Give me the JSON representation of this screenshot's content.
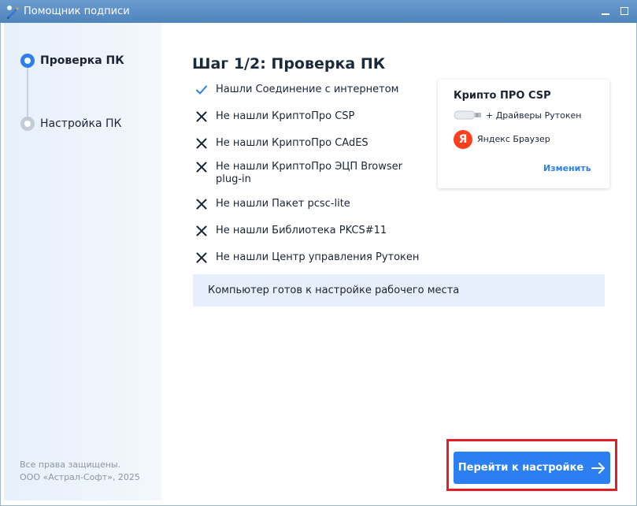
{
  "window": {
    "title": "Помощник подписи",
    "icon": "pen-signature-icon"
  },
  "sidebar": {
    "steps": [
      {
        "label": "Проверка ПК",
        "state": "active"
      },
      {
        "label": "Настройка ПК",
        "state": "inactive"
      }
    ],
    "footer": {
      "line1": "Все права защищены.",
      "line2": "ООО «Астрал-Софт», 2025"
    }
  },
  "main": {
    "title": "Шаг 1/2: Проверка ПК",
    "checks": [
      {
        "label": "Нашли Соединение с интернетом",
        "status": "ok"
      },
      {
        "label": "Не нашли КриптоПро CSP",
        "status": "missing"
      },
      {
        "label": "Не нашли КриптоПро CAdES",
        "status": "missing"
      },
      {
        "label": "Не нашли КриптоПро ЭЦП Browser plug-in",
        "status": "missing"
      },
      {
        "label": "Не нашли Пакет pcsc-lite",
        "status": "missing"
      },
      {
        "label": "Не нашли Библиотека PKCS#11",
        "status": "missing"
      },
      {
        "label": "Не нашли Центр управления Рутокен",
        "status": "missing"
      }
    ],
    "ready_message": "Компьютер готов к настройке рабочего места"
  },
  "product_card": {
    "title": "Крипто ПРО CSP",
    "items": [
      {
        "label": "+ Драйверы Рутокен",
        "icon": "usb-token-icon"
      },
      {
        "label": "Яндекс Браузер",
        "icon": "yandex-browser-icon",
        "glyph": "Я"
      }
    ],
    "change_link": "Изменить"
  },
  "actions": {
    "next_label": "Перейти к настройке"
  },
  "colors": {
    "accent": "#2b7ff0",
    "ok": "#2b7ff0",
    "missing": "#1a2433",
    "highlight": "#e31e24",
    "yandex": "#fc3f1d"
  }
}
